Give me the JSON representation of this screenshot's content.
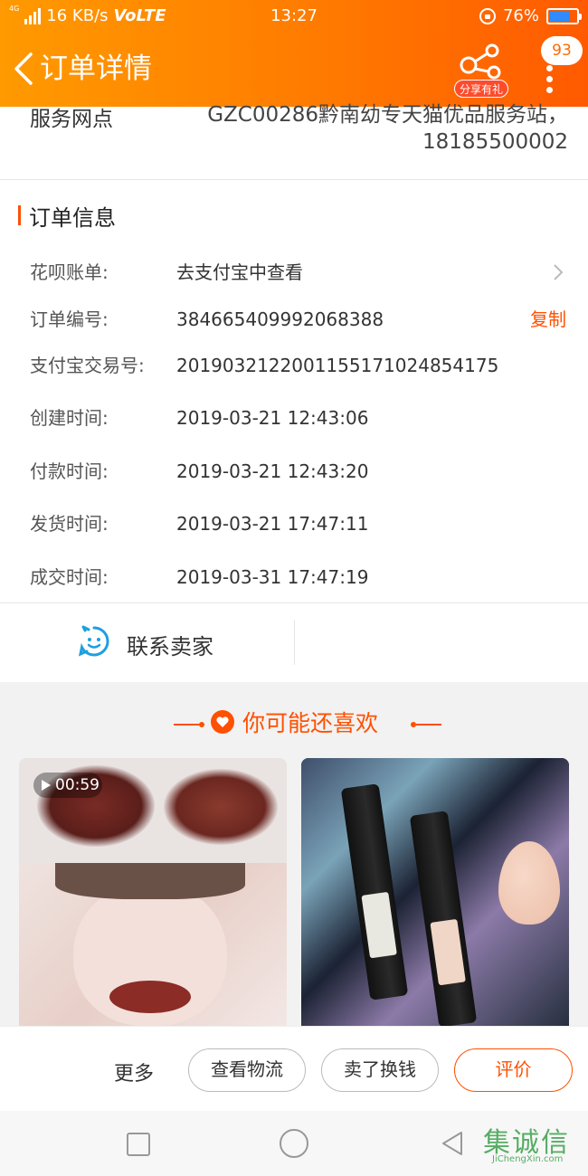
{
  "status_bar": {
    "network": "4G",
    "speed": "16 KB/s",
    "volte": "VoLTE",
    "time": "13:27",
    "battery": "76%",
    "battery_level": 0.76
  },
  "nav": {
    "title": "订单详情",
    "share_label": "分享有礼",
    "message_count": "93"
  },
  "service": {
    "label": "服务网点",
    "value_line1": "GZC00286黔南幼专天猫优品服务站，",
    "value_line2": "18185500002"
  },
  "order_info": {
    "title": "订单信息",
    "rows": [
      {
        "label": "花呗账单:",
        "value": "去支付宝中查看"
      },
      {
        "label": "订单编号:",
        "value": "384665409992068388"
      },
      {
        "label": "支付宝交易号:",
        "value": "2019032122001155171024854175"
      },
      {
        "label": "创建时间:",
        "value": "2019-03-21 12:43:06"
      },
      {
        "label": "付款时间:",
        "value": "2019-03-21 12:43:20"
      },
      {
        "label": "发货时间:",
        "value": "2019-03-21 17:47:11"
      },
      {
        "label": "成交时间:",
        "value": "2019-03-31 17:47:19"
      }
    ],
    "copy_label": "复制"
  },
  "contact": {
    "label": "联系卖家"
  },
  "recommend": {
    "title": "你可能还喜欢",
    "items": [
      {
        "video_duration": "00:59"
      },
      {}
    ]
  },
  "actions": {
    "more": "更多",
    "logistics": "查看物流",
    "sell": "卖了换钱",
    "review": "评价"
  },
  "watermark": {
    "logo": "集诚信",
    "url": "JiChengXin.com"
  },
  "colors": {
    "brand": "#ff5000",
    "header_start": "#ff9a00",
    "header_end": "#ff5a00"
  }
}
